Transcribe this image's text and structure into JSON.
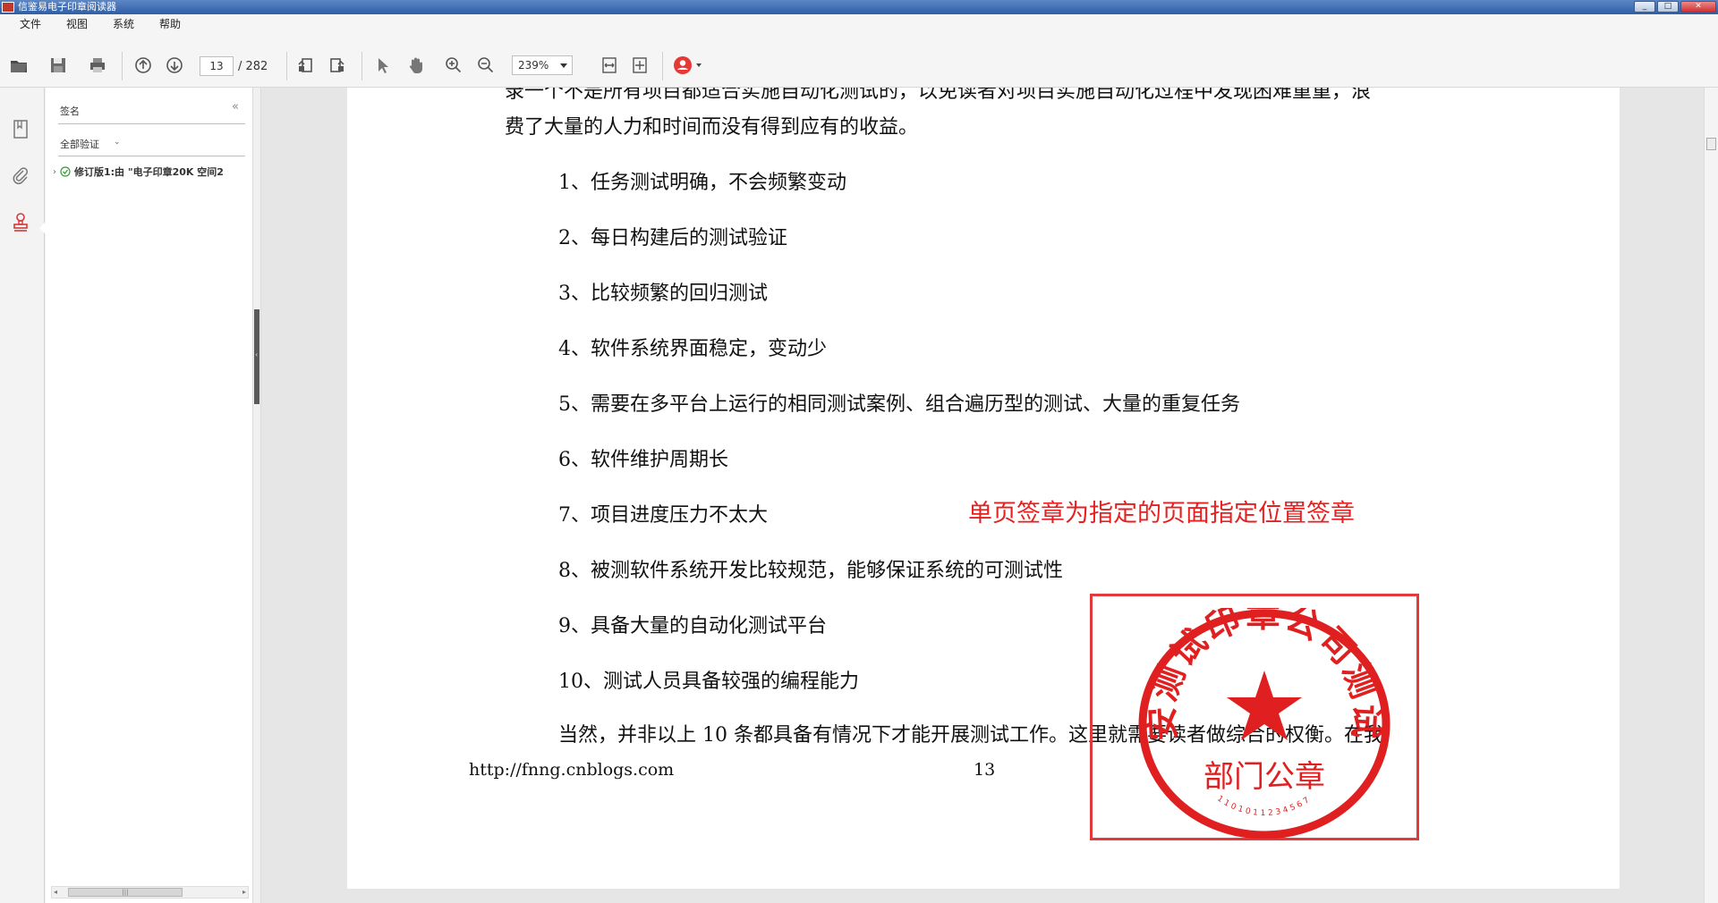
{
  "window": {
    "title": "信鉴易电子印章阅读器"
  },
  "menu": {
    "items": [
      "文件",
      "视图",
      "系统",
      "帮助"
    ]
  },
  "toolbar": {
    "page_current": "13",
    "page_total": "/ 282",
    "zoom": "239%"
  },
  "sidebar": {
    "header": "签名",
    "collapse": "«",
    "verify_all": "全部验证",
    "tree_node": "修订版1:由 \"电子印章20K 空间2"
  },
  "document": {
    "top_line": "录一个不是所有项目都适合实施自动化测试的，以免读者对项目实施自动化过程中发现困难重重，浪",
    "intro_line": "费了大量的人力和时间而没有得到应有的收益。",
    "list": [
      "1、任务测试明确，不会频繁变动",
      "2、每日构建后的测试验证",
      "3、比较频繁的回归测试",
      "4、软件系统界面稳定，变动少",
      "5、需要在多平台上运行的相同测试案例、组合遍历型的测试、大量的重复任务",
      "6、软件维护周期长",
      "7、项目进度压力不太大",
      "8、被测软件系统开发比较规范，能够保证系统的可测试性",
      "9、具备大量的自动化测试平台",
      "10、测试人员具备较强的编程能力"
    ],
    "closing_line": "当然，并非以上 10 条都具备有情况下才能开展测试工作。这里就需要读者做综合的权衡。在我",
    "footer_url": "http://fnng.cnblogs.com",
    "footer_page": "13"
  },
  "annotation": {
    "text": "单页签章为指定的页面指定位置签章"
  },
  "seal": {
    "ring_text": "西安测试印章公司测试部",
    "center_text": "部门公章",
    "code": "1101011234567",
    "color": "#e02020"
  }
}
